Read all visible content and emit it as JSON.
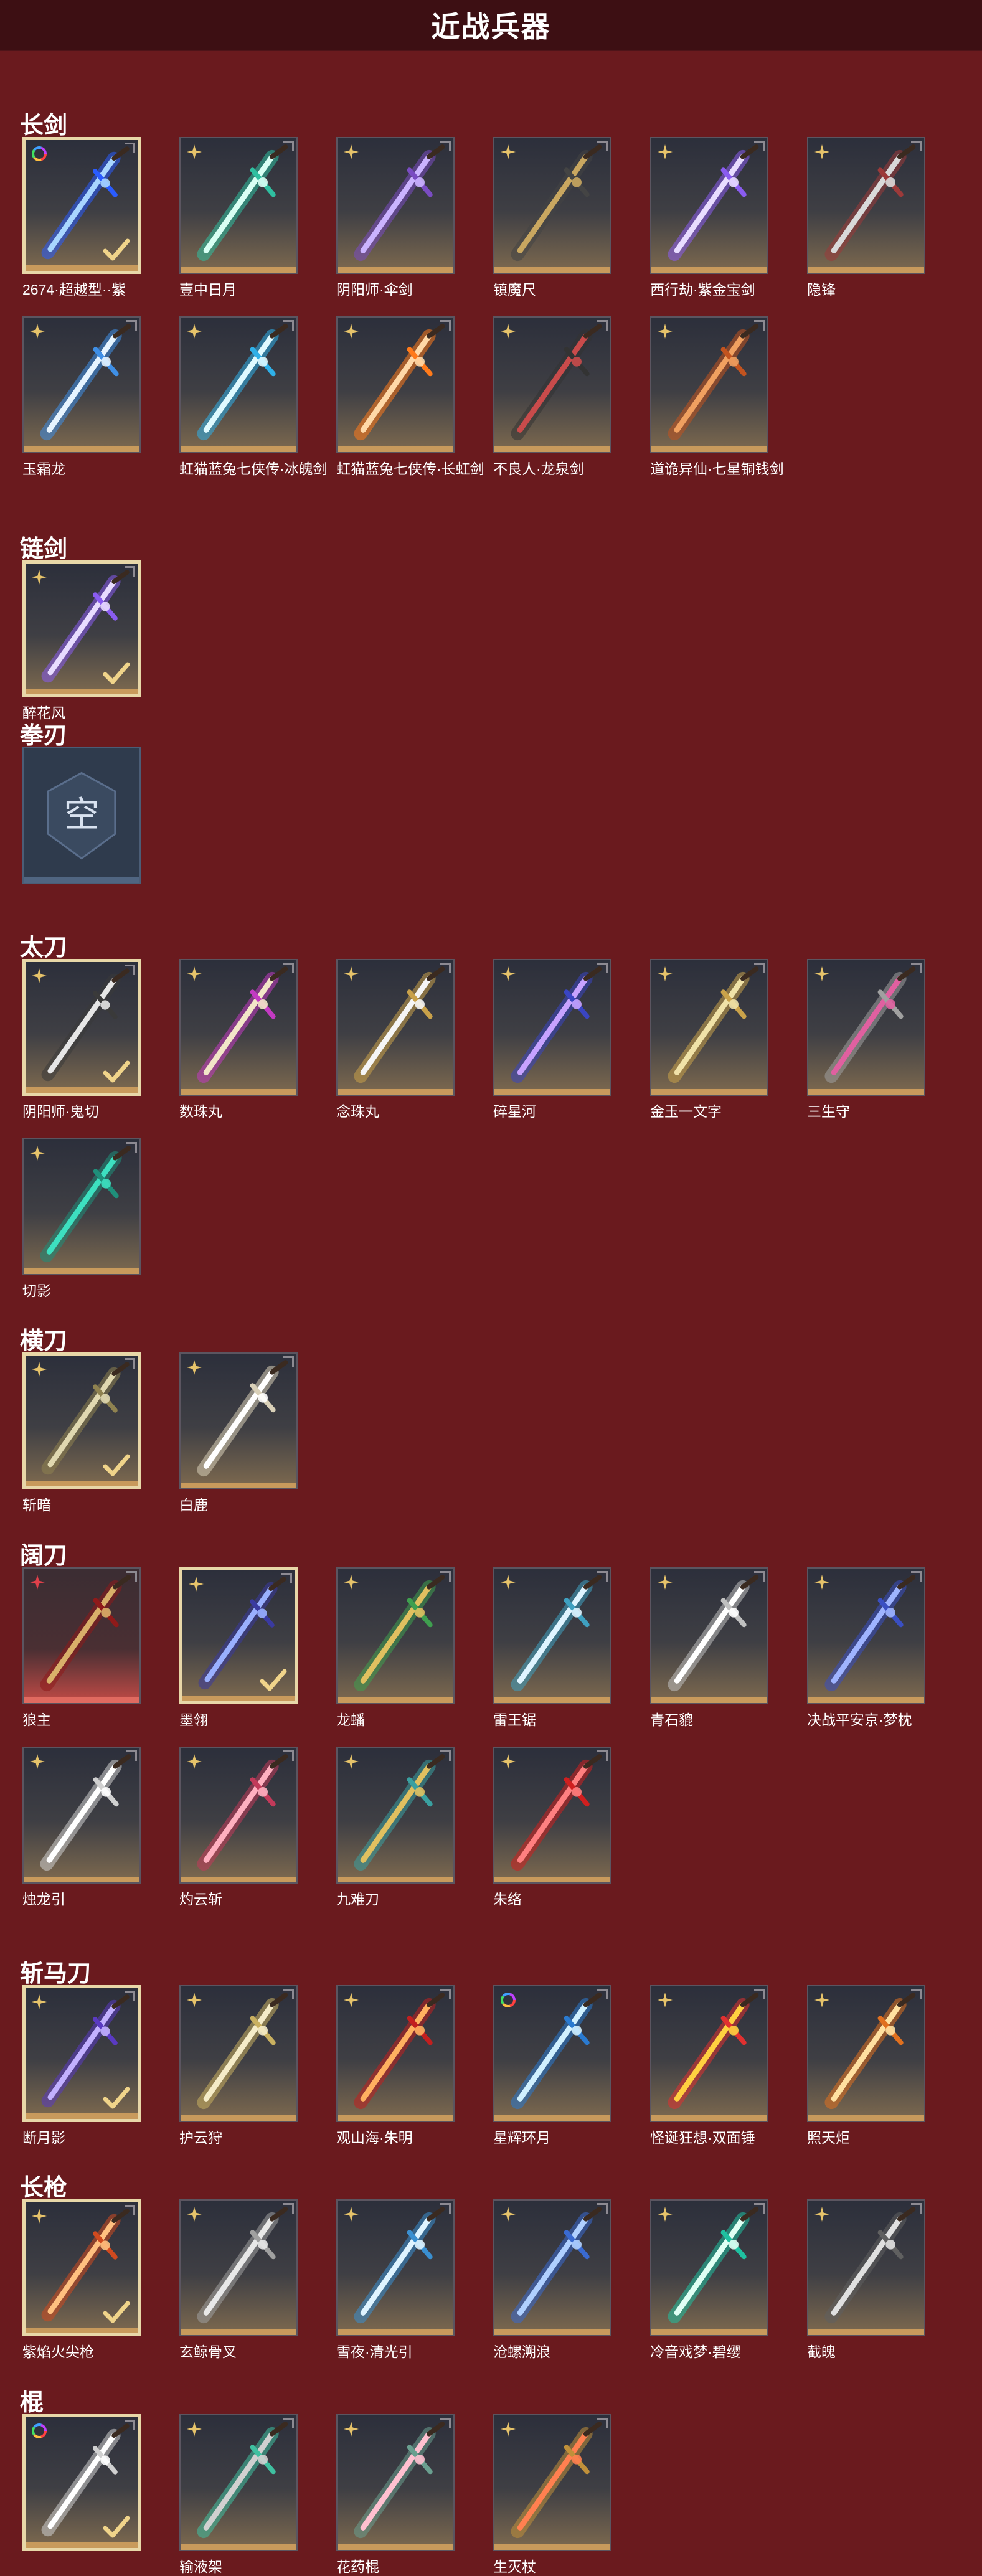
{
  "title": "近战兵器",
  "colors": {
    "background": "#6a1a1e",
    "titlebar": "#3d0f13",
    "card_bottom": "#c89a5c",
    "selected_border": "#e8d7a8"
  },
  "categories": [
    {
      "name": "长剑",
      "items": [
        {
          "name": "2674·超越型··紫",
          "badge": "rainbow-ring",
          "selected": true,
          "c1": "#2a5cff",
          "c2": "#a9d6ff"
        },
        {
          "name": "壹中日月",
          "badge": "gold-star",
          "selected": false,
          "c1": "#2fbfa0",
          "c2": "#d9fff4"
        },
        {
          "name": "阴阳师·伞剑",
          "badge": "gold-star",
          "selected": false,
          "c1": "#7a4cc2",
          "c2": "#cbb3ff"
        },
        {
          "name": "镇魔尺",
          "badge": "gold-star",
          "selected": false,
          "c1": "#444444",
          "c2": "#c9a760"
        },
        {
          "name": "西行劫·紫金宝剑",
          "badge": "gold-star",
          "selected": false,
          "c1": "#8a5cf0",
          "c2": "#e8dcff"
        },
        {
          "name": "隐锋",
          "badge": "gold-star",
          "selected": false,
          "c1": "#9c3a3a",
          "c2": "#d9d9d9"
        },
        {
          "name": "玉霜龙",
          "badge": "gold-star",
          "selected": false,
          "c1": "#3f8fe6",
          "c2": "#e6f4ff"
        },
        {
          "name": "虹猫蓝兔七侠传·冰魄剑",
          "badge": "gold-star",
          "selected": false,
          "c1": "#2fb0e8",
          "c2": "#dffaff"
        },
        {
          "name": "虹猫蓝兔七侠传·长虹剑",
          "badge": "gold-star",
          "selected": false,
          "c1": "#ff7a1a",
          "c2": "#ffd9a8"
        },
        {
          "name": "不良人·龙泉剑",
          "badge": "gold-star",
          "selected": false,
          "c1": "#333333",
          "c2": "#c94b4b"
        },
        {
          "name": "道诡异仙·七星铜钱剑",
          "badge": "gold-star",
          "selected": false,
          "c1": "#c2531f",
          "c2": "#f0a060"
        }
      ]
    },
    {
      "name": "链剑",
      "items": [
        {
          "name": "醉花风",
          "badge": "gold-star",
          "selected": true,
          "c1": "#8a5cf0",
          "c2": "#e8dcff"
        }
      ]
    },
    {
      "name": "拳刃",
      "items": [
        {
          "name": "",
          "empty": true,
          "empty_text": "空"
        }
      ]
    },
    {
      "name": "太刀",
      "items": [
        {
          "name": "阴阳师·鬼切",
          "badge": "gold-star",
          "selected": true,
          "c1": "#3a3a3a",
          "c2": "#e6e6e6"
        },
        {
          "name": "数珠丸",
          "badge": "gold-star",
          "selected": false,
          "c1": "#c23ac2",
          "c2": "#f2e6c8"
        },
        {
          "name": "念珠丸",
          "badge": "gold-star",
          "selected": false,
          "c1": "#c9a14a",
          "c2": "#f5f5f5"
        },
        {
          "name": "碎星河",
          "badge": "gold-star",
          "selected": false,
          "c1": "#3a45c2",
          "c2": "#c7a2ff"
        },
        {
          "name": "金玉一文字",
          "badge": "gold-star",
          "selected": false,
          "c1": "#c9a24a",
          "c2": "#f0e2a8"
        },
        {
          "name": "三生守",
          "badge": "gold-star",
          "selected": false,
          "c1": "#a0a0a0",
          "c2": "#e060a0"
        },
        {
          "name": "切影",
          "badge": "gold-star",
          "selected": false,
          "c1": "#1f8f7a",
          "c2": "#3de0c0"
        }
      ]
    },
    {
      "name": "横刀",
      "items": [
        {
          "name": "斩暗",
          "badge": "gold-star",
          "selected": true,
          "c1": "#8f8250",
          "c2": "#e0d8b0"
        },
        {
          "name": "白鹿",
          "badge": "gold-star",
          "selected": false,
          "c1": "#d9d0b8",
          "c2": "#ffffff"
        }
      ]
    },
    {
      "name": "阔刀",
      "items": [
        {
          "name": "狼主",
          "badge": "red-star",
          "selected": false,
          "red": true,
          "c1": "#8f1a1a",
          "c2": "#d9b06a"
        },
        {
          "name": "墨翎",
          "badge": "gold-star",
          "selected": true,
          "c1": "#3a3aa0",
          "c2": "#9ab0ff"
        },
        {
          "name": "龙蟠",
          "badge": "gold-star",
          "selected": false,
          "c1": "#3f9f4f",
          "c2": "#e0c060"
        },
        {
          "name": "雷王锯",
          "badge": "gold-star",
          "selected": false,
          "c1": "#3fa0c0",
          "c2": "#dff4ff"
        },
        {
          "name": "青石貔",
          "badge": "gold-star",
          "selected": false,
          "c1": "#c0c0c0",
          "c2": "#ffffff"
        },
        {
          "name": "决战平安京·梦枕",
          "badge": "gold-star",
          "selected": false,
          "c1": "#3a4fc2",
          "c2": "#9fb4ff"
        },
        {
          "name": "烛龙引",
          "badge": "gold-star",
          "selected": false,
          "c1": "#d0d0d0",
          "c2": "#ffffff"
        },
        {
          "name": "灼云斩",
          "badge": "gold-star",
          "selected": false,
          "c1": "#c23a5a",
          "c2": "#ffb0c0"
        },
        {
          "name": "九难刀",
          "badge": "gold-star",
          "selected": false,
          "c1": "#3aa0a0",
          "c2": "#e0c060"
        },
        {
          "name": "朱络",
          "badge": "gold-star",
          "selected": false,
          "c1": "#d01f1f",
          "c2": "#ff8080"
        }
      ]
    },
    {
      "name": "斩马刀",
      "items": [
        {
          "name": "断月影",
          "badge": "gold-star",
          "selected": true,
          "c1": "#5a3ac2",
          "c2": "#c2b0ff"
        },
        {
          "name": "护云狩",
          "badge": "gold-star",
          "selected": false,
          "c1": "#c9b060",
          "c2": "#f5ecc8"
        },
        {
          "name": "观山海·朱明",
          "badge": "gold-star",
          "selected": false,
          "c1": "#c21f1f",
          "c2": "#ffb060"
        },
        {
          "name": "星辉环月",
          "badge": "rainbow-ring",
          "selected": false,
          "c1": "#2a7ad0",
          "c2": "#d0f0ff"
        },
        {
          "name": "怪诞狂想·双面锤",
          "badge": "gold-star",
          "selected": false,
          "c1": "#e03030",
          "c2": "#ffd040"
        },
        {
          "name": "照天炬",
          "badge": "gold-star",
          "selected": false,
          "c1": "#e0701f",
          "c2": "#ffe0a0"
        }
      ]
    },
    {
      "name": "长枪",
      "items": [
        {
          "name": "紫焰火尖枪",
          "badge": "gold-star",
          "selected": true,
          "c1": "#d04a1f",
          "c2": "#ffc080"
        },
        {
          "name": "玄鲸骨叉",
          "badge": "gold-star",
          "selected": false,
          "c1": "#a0a0a0",
          "c2": "#e8e8e8"
        },
        {
          "name": "雪夜·清光引",
          "badge": "gold-star",
          "selected": false,
          "c1": "#3a8fd0",
          "c2": "#dff4ff"
        },
        {
          "name": "沧螺溯浪",
          "badge": "gold-star",
          "selected": false,
          "c1": "#3a6ad0",
          "c2": "#b0d0ff"
        },
        {
          "name": "冷音戏梦·碧缨",
          "badge": "gold-star",
          "selected": false,
          "c1": "#1fc0a0",
          "c2": "#e0fff4"
        },
        {
          "name": "截魄",
          "badge": "gold-star",
          "selected": false,
          "c1": "#606060",
          "c2": "#e0e0e0"
        }
      ]
    },
    {
      "name": "棍",
      "items": [
        {
          "name": "",
          "badge": "rainbow-ring",
          "selected": true,
          "c1": "#d0d0d0",
          "c2": "#ffffff"
        },
        {
          "name": "输液架",
          "badge": "gold-star",
          "selected": false,
          "c1": "#3fc0a0",
          "c2": "#d0d0d0"
        },
        {
          "name": "花药棍",
          "badge": "gold-star",
          "selected": false,
          "c1": "#6a9f8f",
          "c2": "#ffc0d0"
        },
        {
          "name": "生灭杖",
          "badge": "gold-star",
          "selected": false,
          "c1": "#c0903a",
          "c2": "#ff8050"
        }
      ]
    }
  ]
}
